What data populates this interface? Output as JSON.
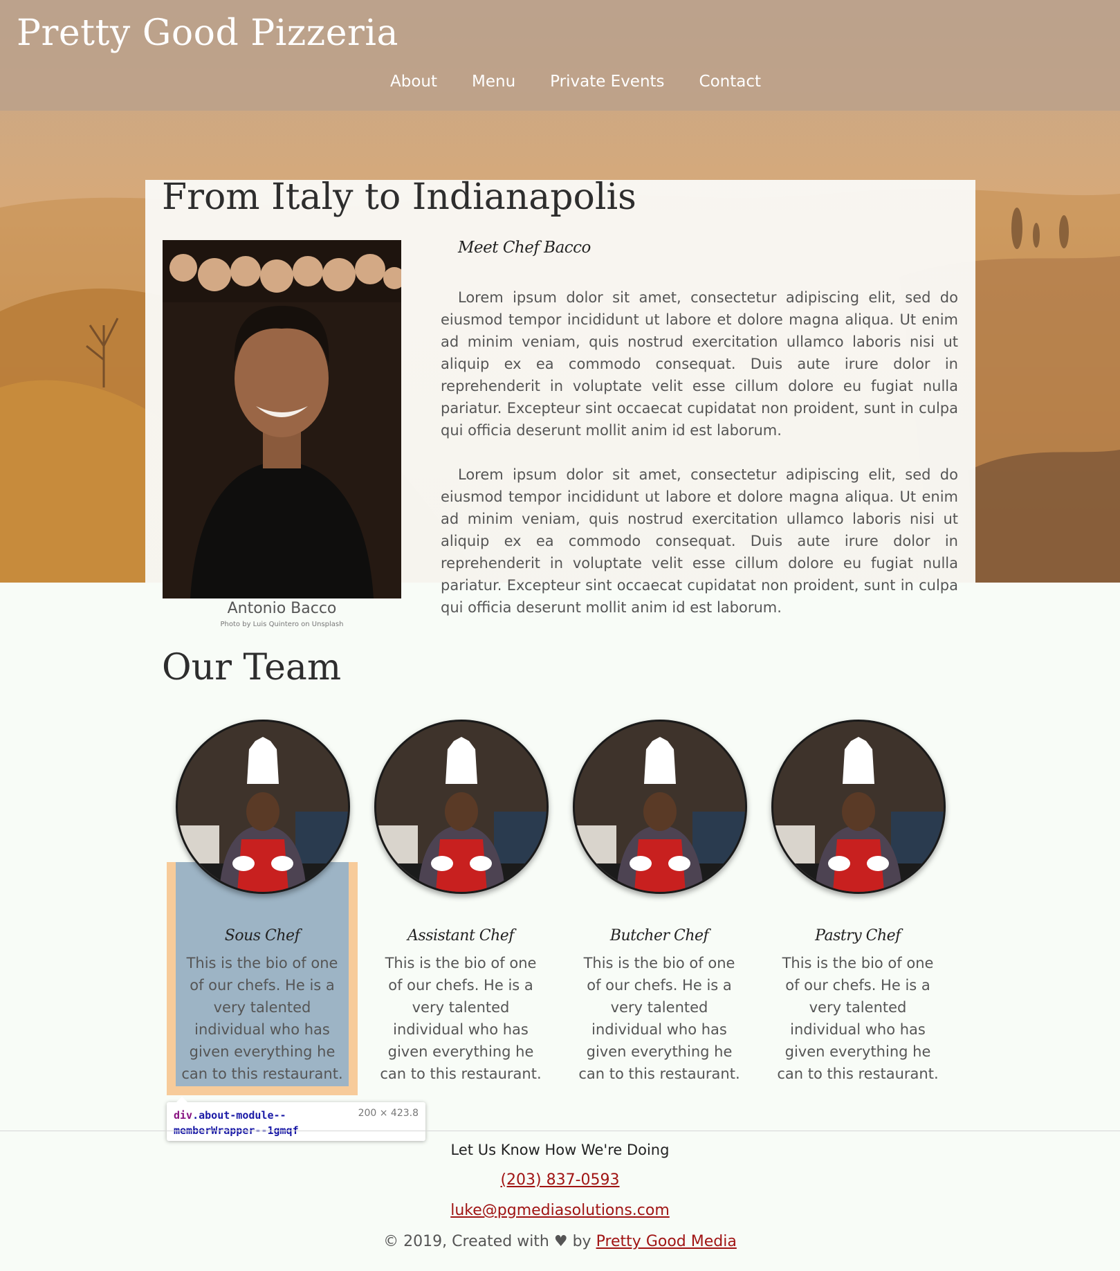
{
  "site": {
    "title": "Pretty Good Pizzeria"
  },
  "nav": [
    {
      "label": "About"
    },
    {
      "label": "Menu"
    },
    {
      "label": "Private Events"
    },
    {
      "label": "Contact"
    }
  ],
  "about": {
    "title": "From Italy to Indianapolis",
    "chef_name": "Antonio Bacco",
    "photo_credit": "Photo by Luis Quintero on Unsplash",
    "meet_heading": "Meet Chef Bacco",
    "paragraphs": [
      "Lorem ipsum dolor sit amet, consectetur adipiscing elit, sed do eiusmod tempor incididunt ut labore et dolore magna aliqua. Ut enim ad minim veniam, quis nostrud exercitation ullamco laboris nisi ut aliquip ex ea commodo consequat. Duis aute irure dolor in reprehenderit in voluptate velit esse cillum dolore eu fugiat nulla pariatur. Excepteur sint occaecat cupidatat non proident, sunt in culpa qui officia deserunt mollit anim id est laborum.",
      "Lorem ipsum dolor sit amet, consectetur adipiscing elit, sed do eiusmod tempor incididunt ut labore et dolore magna aliqua. Ut enim ad minim veniam, quis nostrud exercitation ullamco laboris nisi ut aliquip ex ea commodo consequat. Duis aute irure dolor in reprehenderit in voluptate velit esse cillum dolore eu fugiat nulla pariatur. Excepteur sint occaecat cupidatat non proident, sunt in culpa qui officia deserunt mollit anim id est laborum."
    ]
  },
  "team": {
    "title": "Our Team",
    "members": [
      {
        "role": "Sous Chef",
        "bio": "This is the bio of one of our chefs. He is a very talented individual who has given everything he can to this restaurant."
      },
      {
        "role": "Assistant Chef",
        "bio": "This is the bio of one of our chefs. He is a very talented individual who has given everything he can to this restaurant."
      },
      {
        "role": "Butcher Chef",
        "bio": "This is the bio of one of our chefs. He is a very talented individual who has given everything he can to this restaurant."
      },
      {
        "role": "Pastry Chef",
        "bio": "This is the bio of one of our chefs. He is a very talented individual who has given everything he can to this restaurant."
      }
    ]
  },
  "devtools_tooltip": {
    "tag": "div",
    "class_name": ".about-module--memberWrapper--1gmqf",
    "size": "200 × 423.8"
  },
  "footer": {
    "heading": "Let Us Know How We're Doing",
    "phone": "(203) 837-0593",
    "email": "luke@pgmediasolutions.com",
    "copyright_prefix": "© 2019, Created with ♥ by",
    "credit_link": "Pretty Good Media"
  },
  "colors": {
    "link": "#a01414",
    "highlight_content": "#6fa8dc",
    "highlight_margin": "#f6b26b"
  }
}
